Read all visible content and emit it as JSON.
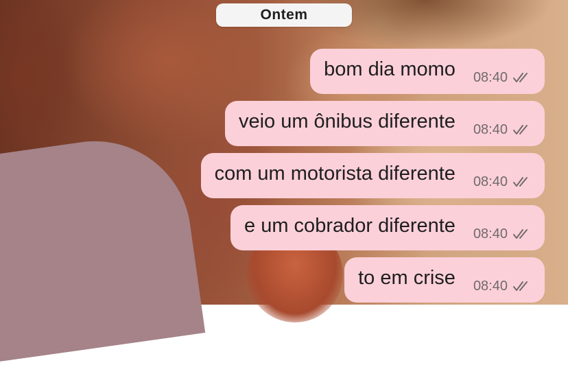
{
  "chat": {
    "date_separator": "Ontem",
    "messages": [
      {
        "text": "bom dia momo",
        "time": "08:40",
        "status_icon": "double-check-icon"
      },
      {
        "text": "veio um ônibus diferente",
        "time": "08:40",
        "status_icon": "double-check-icon"
      },
      {
        "text": "com um motorista diferente",
        "time": "08:40",
        "status_icon": "double-check-icon"
      },
      {
        "text": "e um cobrador diferente",
        "time": "08:40",
        "status_icon": "double-check-icon"
      },
      {
        "text": "to em crise",
        "time": "08:40",
        "status_icon": "double-check-icon"
      }
    ]
  },
  "colors": {
    "outgoing_bubble": "#fcd0d9",
    "date_pill": "#f4f4f4",
    "timestamp": "#6f6a6c"
  }
}
